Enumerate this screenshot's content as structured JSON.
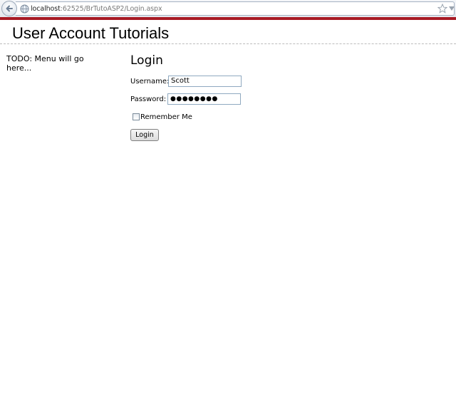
{
  "browser": {
    "url_host": "localhost",
    "url_rest": ":62525/BrTutoASP2/Login.aspx"
  },
  "site": {
    "title": "User Account Tutorials",
    "menu_placeholder": "TODO: Menu will go here..."
  },
  "login": {
    "heading": "Login",
    "username_label": "Username:",
    "username_value": "Scott",
    "password_label": "Password:",
    "password_masked": "●●●●●●●●",
    "remember_label": "Remember Me",
    "remember_checked": false,
    "button_label": "Login"
  },
  "colors": {
    "accent_bar": "#a81a24",
    "chrome_bg": "#e4e8ee"
  }
}
